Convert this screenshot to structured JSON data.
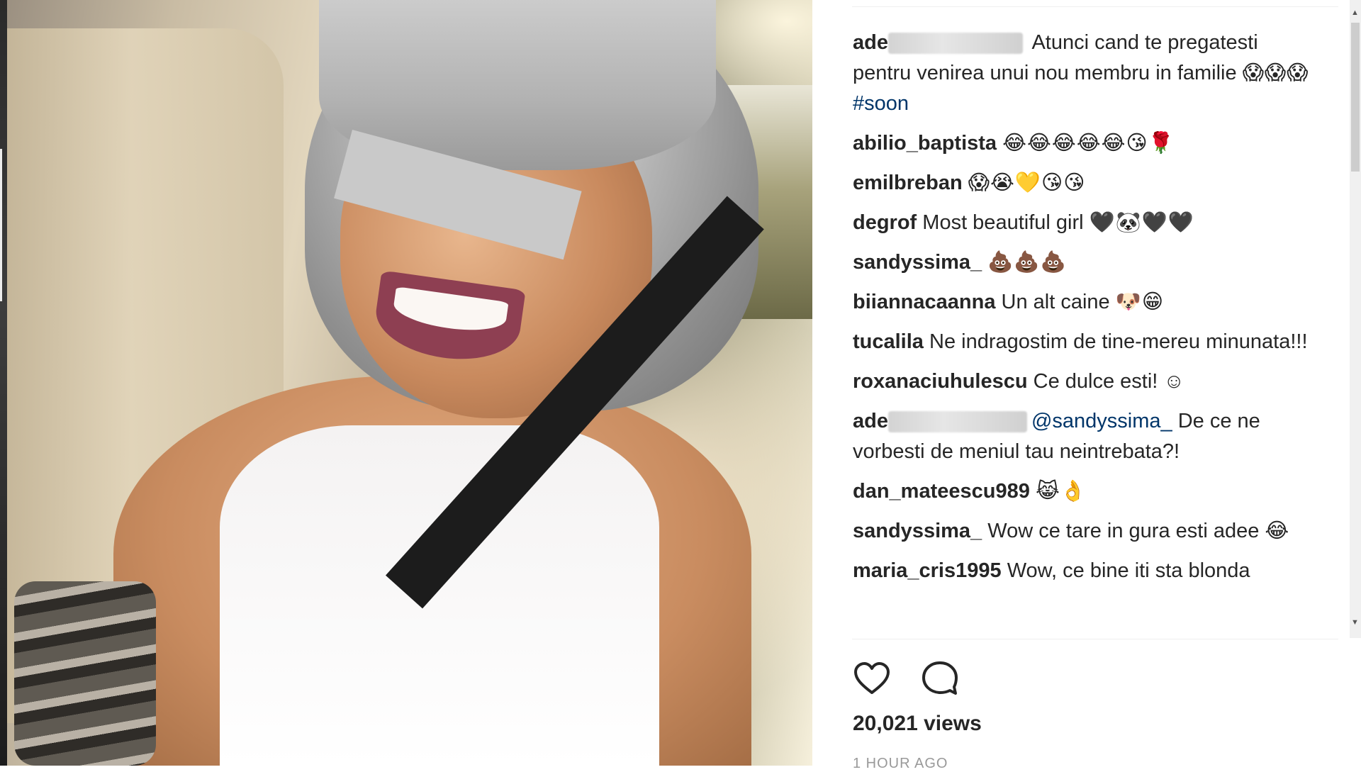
{
  "post": {
    "caption": {
      "user": "ade",
      "text": "Atunci cand te pregatesti pentru venirea unui nou membru in familie ",
      "emoji": "😱😱😱",
      "hashtag": "#soon"
    },
    "comments": [
      {
        "user": "abilio_baptista",
        "text": "",
        "emoji": "😂😂😂😂😂😘🌹"
      },
      {
        "user": "emilbreban",
        "text": "",
        "emoji": "😱😭💛😘😘"
      },
      {
        "user": "degrof",
        "text": "Most beautiful girl ",
        "emoji": "🖤🐼🖤🖤"
      },
      {
        "user": "sandyssima_",
        "text": "",
        "emoji": "💩💩💩"
      },
      {
        "user": "biiannacaanna",
        "text": "Un alt caine ",
        "emoji": "🐶😁"
      },
      {
        "user": "tucalila",
        "text": "Ne indragostim de tine-mereu minunata!!!",
        "emoji": ""
      },
      {
        "user": "roxanaciuhulescu",
        "text": "Ce dulce esti! ",
        "emoji": "☺"
      },
      {
        "user": "ade",
        "mention": "@sandyssima_",
        "text": " De ce ne vorbesti de meniul tau neintrebata?!",
        "emoji": ""
      },
      {
        "user": "dan_mateescu989",
        "text": "",
        "emoji": "😹👌"
      },
      {
        "user": "sandyssima_",
        "text": "Wow ce tare in gura esti adee ",
        "emoji": "😂"
      },
      {
        "user": "maria_cris1995",
        "text": "Wow, ce bine iti sta blonda",
        "emoji": ""
      }
    ],
    "views": "20,021 views",
    "time": "1 HOUR AGO"
  },
  "icons": {
    "like": "heart-icon",
    "comment": "comment-bubble-icon"
  },
  "colors": {
    "link": "#003569",
    "text": "#262626",
    "muted": "#999999"
  }
}
